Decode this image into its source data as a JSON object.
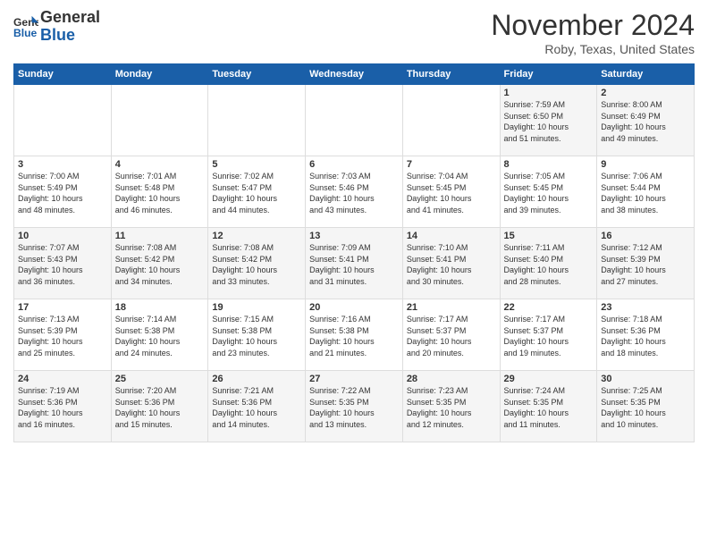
{
  "logo": {
    "line1": "General",
    "line2": "Blue"
  },
  "title": "November 2024",
  "subtitle": "Roby, Texas, United States",
  "days_of_week": [
    "Sunday",
    "Monday",
    "Tuesday",
    "Wednesday",
    "Thursday",
    "Friday",
    "Saturday"
  ],
  "weeks": [
    [
      {
        "num": "",
        "info": ""
      },
      {
        "num": "",
        "info": ""
      },
      {
        "num": "",
        "info": ""
      },
      {
        "num": "",
        "info": ""
      },
      {
        "num": "",
        "info": ""
      },
      {
        "num": "1",
        "info": "Sunrise: 7:59 AM\nSunset: 6:50 PM\nDaylight: 10 hours\nand 51 minutes."
      },
      {
        "num": "2",
        "info": "Sunrise: 8:00 AM\nSunset: 6:49 PM\nDaylight: 10 hours\nand 49 minutes."
      }
    ],
    [
      {
        "num": "3",
        "info": "Sunrise: 7:00 AM\nSunset: 5:49 PM\nDaylight: 10 hours\nand 48 minutes."
      },
      {
        "num": "4",
        "info": "Sunrise: 7:01 AM\nSunset: 5:48 PM\nDaylight: 10 hours\nand 46 minutes."
      },
      {
        "num": "5",
        "info": "Sunrise: 7:02 AM\nSunset: 5:47 PM\nDaylight: 10 hours\nand 44 minutes."
      },
      {
        "num": "6",
        "info": "Sunrise: 7:03 AM\nSunset: 5:46 PM\nDaylight: 10 hours\nand 43 minutes."
      },
      {
        "num": "7",
        "info": "Sunrise: 7:04 AM\nSunset: 5:45 PM\nDaylight: 10 hours\nand 41 minutes."
      },
      {
        "num": "8",
        "info": "Sunrise: 7:05 AM\nSunset: 5:45 PM\nDaylight: 10 hours\nand 39 minutes."
      },
      {
        "num": "9",
        "info": "Sunrise: 7:06 AM\nSunset: 5:44 PM\nDaylight: 10 hours\nand 38 minutes."
      }
    ],
    [
      {
        "num": "10",
        "info": "Sunrise: 7:07 AM\nSunset: 5:43 PM\nDaylight: 10 hours\nand 36 minutes."
      },
      {
        "num": "11",
        "info": "Sunrise: 7:08 AM\nSunset: 5:42 PM\nDaylight: 10 hours\nand 34 minutes."
      },
      {
        "num": "12",
        "info": "Sunrise: 7:08 AM\nSunset: 5:42 PM\nDaylight: 10 hours\nand 33 minutes."
      },
      {
        "num": "13",
        "info": "Sunrise: 7:09 AM\nSunset: 5:41 PM\nDaylight: 10 hours\nand 31 minutes."
      },
      {
        "num": "14",
        "info": "Sunrise: 7:10 AM\nSunset: 5:41 PM\nDaylight: 10 hours\nand 30 minutes."
      },
      {
        "num": "15",
        "info": "Sunrise: 7:11 AM\nSunset: 5:40 PM\nDaylight: 10 hours\nand 28 minutes."
      },
      {
        "num": "16",
        "info": "Sunrise: 7:12 AM\nSunset: 5:39 PM\nDaylight: 10 hours\nand 27 minutes."
      }
    ],
    [
      {
        "num": "17",
        "info": "Sunrise: 7:13 AM\nSunset: 5:39 PM\nDaylight: 10 hours\nand 25 minutes."
      },
      {
        "num": "18",
        "info": "Sunrise: 7:14 AM\nSunset: 5:38 PM\nDaylight: 10 hours\nand 24 minutes."
      },
      {
        "num": "19",
        "info": "Sunrise: 7:15 AM\nSunset: 5:38 PM\nDaylight: 10 hours\nand 23 minutes."
      },
      {
        "num": "20",
        "info": "Sunrise: 7:16 AM\nSunset: 5:38 PM\nDaylight: 10 hours\nand 21 minutes."
      },
      {
        "num": "21",
        "info": "Sunrise: 7:17 AM\nSunset: 5:37 PM\nDaylight: 10 hours\nand 20 minutes."
      },
      {
        "num": "22",
        "info": "Sunrise: 7:17 AM\nSunset: 5:37 PM\nDaylight: 10 hours\nand 19 minutes."
      },
      {
        "num": "23",
        "info": "Sunrise: 7:18 AM\nSunset: 5:36 PM\nDaylight: 10 hours\nand 18 minutes."
      }
    ],
    [
      {
        "num": "24",
        "info": "Sunrise: 7:19 AM\nSunset: 5:36 PM\nDaylight: 10 hours\nand 16 minutes."
      },
      {
        "num": "25",
        "info": "Sunrise: 7:20 AM\nSunset: 5:36 PM\nDaylight: 10 hours\nand 15 minutes."
      },
      {
        "num": "26",
        "info": "Sunrise: 7:21 AM\nSunset: 5:36 PM\nDaylight: 10 hours\nand 14 minutes."
      },
      {
        "num": "27",
        "info": "Sunrise: 7:22 AM\nSunset: 5:35 PM\nDaylight: 10 hours\nand 13 minutes."
      },
      {
        "num": "28",
        "info": "Sunrise: 7:23 AM\nSunset: 5:35 PM\nDaylight: 10 hours\nand 12 minutes."
      },
      {
        "num": "29",
        "info": "Sunrise: 7:24 AM\nSunset: 5:35 PM\nDaylight: 10 hours\nand 11 minutes."
      },
      {
        "num": "30",
        "info": "Sunrise: 7:25 AM\nSunset: 5:35 PM\nDaylight: 10 hours\nand 10 minutes."
      }
    ]
  ]
}
